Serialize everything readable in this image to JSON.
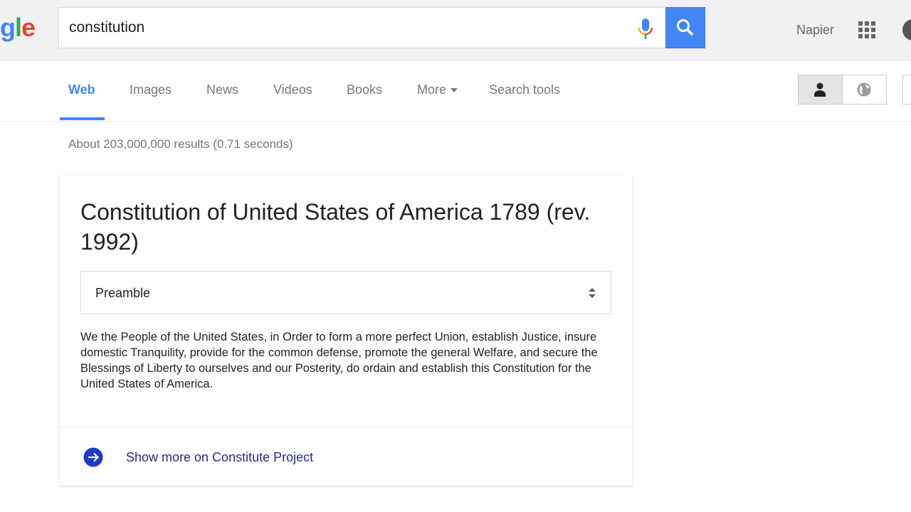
{
  "header": {
    "logo_text": "gle",
    "search_value": "constitution",
    "user_name": "Napier"
  },
  "nav": {
    "tabs": [
      {
        "label": "Web",
        "active": true
      },
      {
        "label": "Images"
      },
      {
        "label": "News"
      },
      {
        "label": "Videos"
      },
      {
        "label": "Books"
      },
      {
        "label": "More"
      },
      {
        "label": "Search tools"
      }
    ]
  },
  "results": {
    "stats": "About 203,000,000 results (0.71 seconds)"
  },
  "card": {
    "title": "Constitution of United States of America 1789 (rev. 1992)",
    "section_select": "Preamble",
    "text": "We the People of the United States, in Order to form a more perfect Union, establish Justice, insure domestic Tranquility, provide for the common defense, promote the general Welfare, and secure the Blessings of Liberty to ourselves and our Posterity, do ordain and establish this Constitution for the United States of America.",
    "more_link": "Show more on Constitute Project"
  },
  "colors": {
    "accent": "#4285f4",
    "link": "#1a0dab",
    "arrow": "#1a3bcc"
  }
}
